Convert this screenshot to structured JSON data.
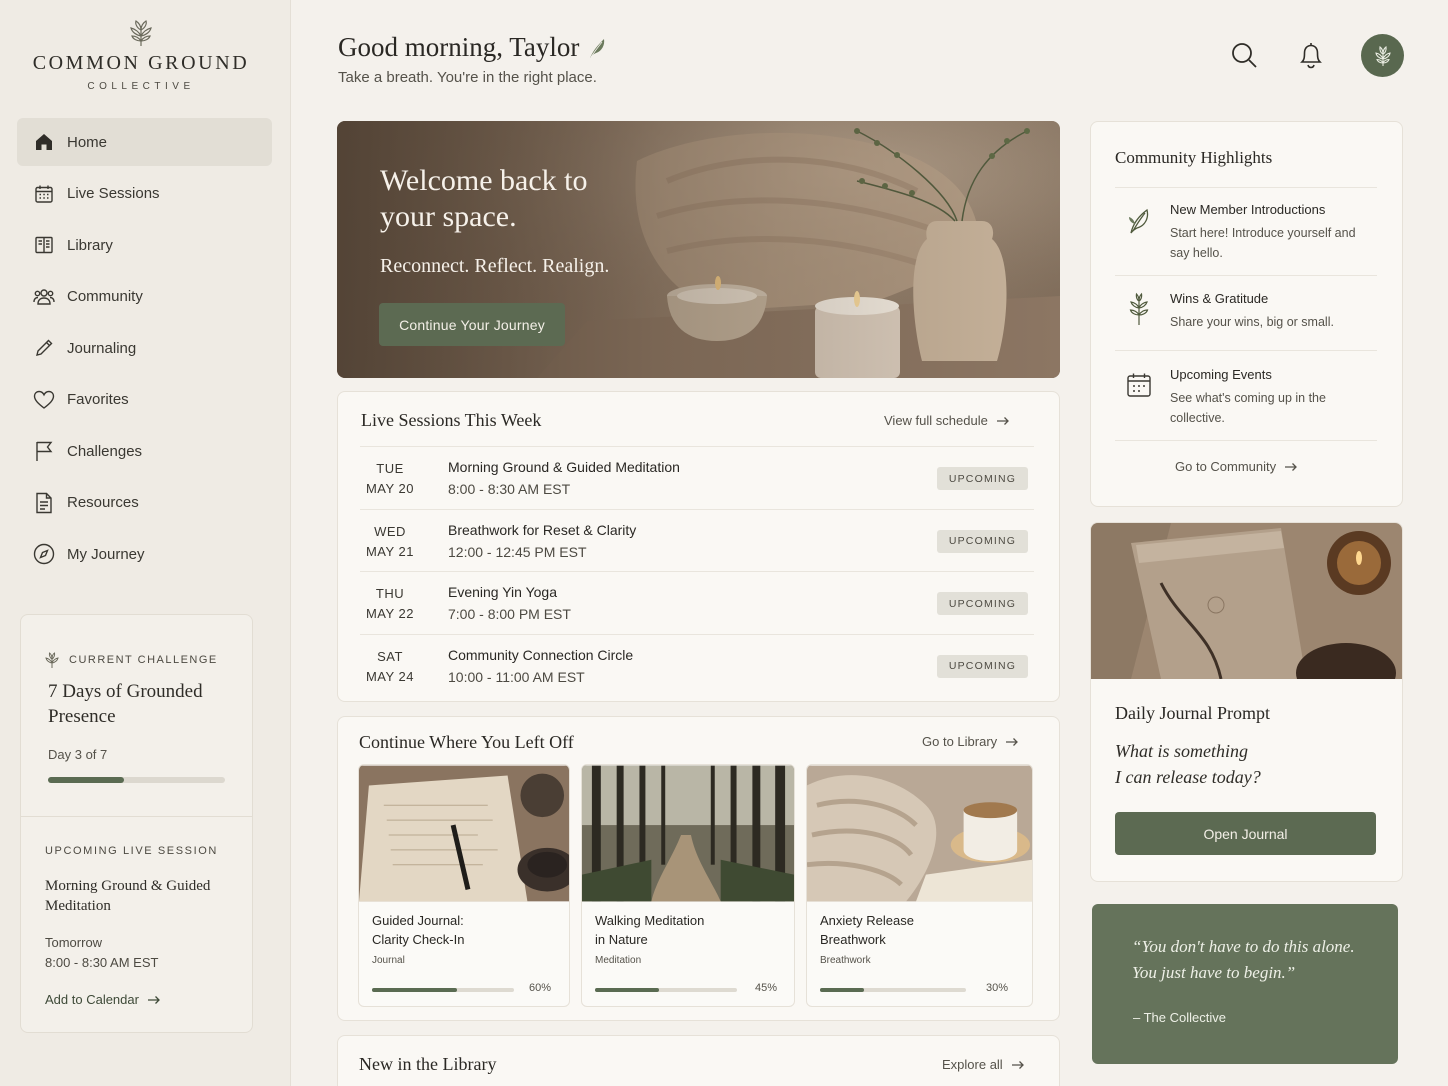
{
  "brand": {
    "name": "COMMON GROUND",
    "sub": "COLLECTIVE"
  },
  "nav": [
    {
      "label": "Home",
      "icon": "home-icon",
      "active": true
    },
    {
      "label": "Live Sessions",
      "icon": "calendar-icon"
    },
    {
      "label": "Library",
      "icon": "book-icon"
    },
    {
      "label": "Community",
      "icon": "people-icon"
    },
    {
      "label": "Journaling",
      "icon": "pencil-icon"
    },
    {
      "label": "Favorites",
      "icon": "heart-icon"
    },
    {
      "label": "Challenges",
      "icon": "flag-icon"
    },
    {
      "label": "Resources",
      "icon": "document-icon"
    },
    {
      "label": "My Journey",
      "icon": "compass-icon"
    }
  ],
  "challenge": {
    "label": "CURRENT CHALLENGE",
    "title": "7 Days of Grounded Presence",
    "day": "Day 3 of 7",
    "progress": 0.43
  },
  "upcoming": {
    "label": "UPCOMING LIVE SESSION",
    "title": "Morning Ground & Guided Meditation",
    "day": "Tomorrow",
    "time": "8:00 - 8:30 AM EST",
    "add": "Add to Calendar"
  },
  "header": {
    "greeting": "Good morning, Taylor",
    "subtitle": "Take a breath. You're in the right place."
  },
  "hero": {
    "title": "Welcome back to your space.",
    "subtitle": "Reconnect. Reflect. Realign.",
    "button": "Continue Your Journey"
  },
  "sessions": {
    "title": "Live Sessions This Week",
    "link": "View full schedule",
    "items": [
      {
        "dow": "TUE",
        "date": "MAY 20",
        "name": "Morning Ground & Guided Meditation",
        "time": "8:00 - 8:30 AM EST",
        "status": "UPCOMING"
      },
      {
        "dow": "WED",
        "date": "MAY 21",
        "name": "Breathwork for Reset & Clarity",
        "time": "12:00 - 12:45 PM EST",
        "status": "UPCOMING"
      },
      {
        "dow": "THU",
        "date": "MAY 22",
        "name": "Evening Yin Yoga",
        "time": "7:00 - 8:00 PM EST",
        "status": "UPCOMING"
      },
      {
        "dow": "SAT",
        "date": "MAY 24",
        "name": "Community Connection Circle",
        "time": "10:00 - 11:00 AM EST",
        "status": "UPCOMING"
      }
    ]
  },
  "continue": {
    "title": "Continue Where You Left Off",
    "link": "Go to Library",
    "items": [
      {
        "line1": "Guided Journal:",
        "line2": "Clarity Check-In",
        "category": "Journal",
        "progress": 60,
        "progress_label": "60%"
      },
      {
        "line1": "Walking Meditation",
        "line2": "in Nature",
        "category": "Meditation",
        "progress": 45,
        "progress_label": "45%"
      },
      {
        "line1": "Anxiety Release",
        "line2": "Breathwork",
        "category": "Breathwork",
        "progress": 30,
        "progress_label": "30%"
      }
    ]
  },
  "library": {
    "title": "New in the Library",
    "link": "Explore all"
  },
  "community": {
    "title": "Community Highlights",
    "items": [
      {
        "name": "New Member Introductions",
        "desc": "Start here! Introduce yourself and say hello.",
        "icon": "leaf-icon"
      },
      {
        "name": "Wins & Gratitude",
        "desc": "Share your wins, big or small.",
        "icon": "plant-icon"
      },
      {
        "name": "Upcoming Events",
        "desc": "See what's coming up in the collective.",
        "icon": "calendar-icon"
      }
    ],
    "link": "Go to Community"
  },
  "journal": {
    "title": "Daily Journal Prompt",
    "prompt_line1": "What is something",
    "prompt_line2": "I can release today?",
    "button": "Open Journal"
  },
  "quote": {
    "line1": "“You don't have to do this alone.",
    "line2": "You just have to begin.”",
    "author": "– The Collective"
  },
  "colors": {
    "accent": "#5c6a52",
    "background": "#f4f1ec",
    "quote_bg": "#65735b"
  }
}
